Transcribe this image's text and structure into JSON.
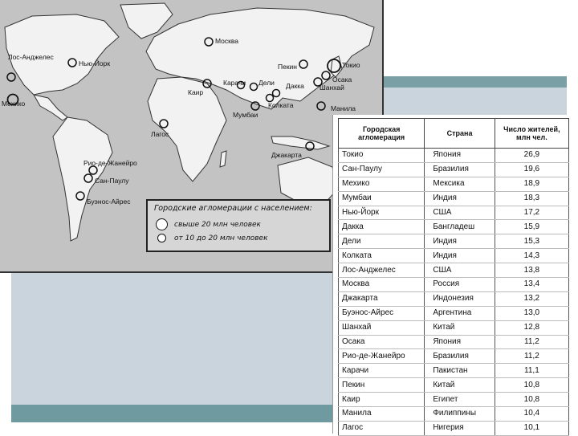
{
  "map": {
    "legend": {
      "title": "Городские агломерации с населением:",
      "items": [
        "свыше 20 млн человек",
        "от 10 до 20 млн человек"
      ]
    },
    "city_labels": [
      "Лос-Анджелес",
      "Нью-Йорк",
      "Мехико",
      "Москва",
      "Пекин",
      "Токио",
      "Карачи",
      "Дели",
      "Дакка",
      "Осака",
      "Шанхай",
      "Каир",
      "Колката",
      "Мумбаи",
      "Манила",
      "Лагос",
      "Джакарта",
      "Рио-де-Жанейро",
      "Сан-Паулу",
      "Буэнос-Айрес"
    ]
  },
  "table": {
    "headers": [
      "Городская агломерация",
      "Страна",
      "Число жителей, млн чел."
    ],
    "rows": [
      [
        "Токио",
        "Япония",
        "26,9"
      ],
      [
        "Сан-Паулу",
        "Бразилия",
        "19,6"
      ],
      [
        "Мехико",
        "Мексика",
        "18,9"
      ],
      [
        "Мумбаи",
        "Индия",
        "18,3"
      ],
      [
        "Нью-Йорк",
        "США",
        "17,2"
      ],
      [
        "Дакка",
        "Бангладеш",
        "15,9"
      ],
      [
        "Дели",
        "Индия",
        "15,3"
      ],
      [
        "Колката",
        "Индия",
        "14,3"
      ],
      [
        "Лос-Анджелес",
        "США",
        "13,8"
      ],
      [
        "Москва",
        "Россия",
        "13,4"
      ],
      [
        "Джакарта",
        "Индонезия",
        "13,2"
      ],
      [
        "Буэнос-Айрес",
        "Аргентина",
        "13,0"
      ],
      [
        "Шанхай",
        "Китай",
        "12,8"
      ],
      [
        "Осака",
        "Япония",
        "11,2"
      ],
      [
        "Рио-де-Жанейро",
        "Бразилия",
        "11,2"
      ],
      [
        "Карачи",
        "Пакистан",
        "11,1"
      ],
      [
        "Пекин",
        "Китай",
        "10,8"
      ],
      [
        "Каир",
        "Египет",
        "10,8"
      ],
      [
        "Манила",
        "Филиппины",
        "10,4"
      ],
      [
        "Лагос",
        "Нигерия",
        "10,1"
      ]
    ]
  },
  "colors": {
    "teal": "#7aa0a6",
    "panel": "#c9d4dc",
    "map_bg": "#c3c3c3",
    "land": "#f2f2f2"
  }
}
